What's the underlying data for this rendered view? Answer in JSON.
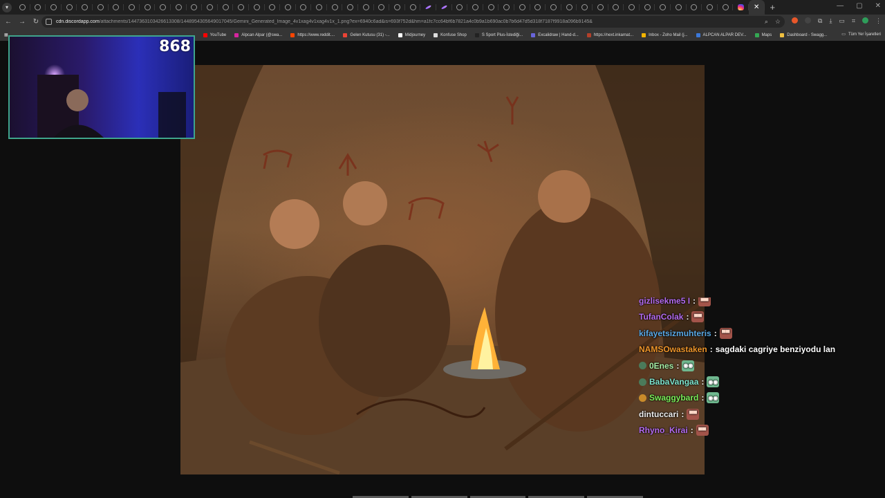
{
  "browser": {
    "tab_count": 48,
    "active_tab_close": "✕",
    "new_tab": "+",
    "url_host": "cdn.discordapp.com",
    "url_path": "/attachments/1447363103426613308/1448954305649017045/Gemini_Generated_Image_4v1xag4v1xag4v1x_1.png?ex=6940c6ad&is=693f752d&hm=a1fc7cc64bf6b7821a4c0b9a1b690ac0b7b6d47d5d318f7187f9918a096b9145&",
    "window": {
      "minimize": "—",
      "maximize": "▢",
      "close": "✕"
    }
  },
  "bookmarks": [
    {
      "label": "YouTube",
      "color": "#ff0000"
    },
    {
      "label": "Alpcan Alpar (@swa...",
      "color": "#d6249f"
    },
    {
      "label": "https://www.reddit....",
      "color": "#ff4500"
    },
    {
      "label": "Gelen Kutusu (31) -...",
      "color": "#ea4335"
    },
    {
      "label": "Midjourney",
      "color": "#ffffff"
    },
    {
      "label": "Konfuse Shop",
      "color": "#dddddd"
    },
    {
      "label": "S Sport Plus-İstediği...",
      "color": "#222222"
    },
    {
      "label": "Excalidraw | Hand-d...",
      "color": "#6965db"
    },
    {
      "label": "https://next.inkarnat...",
      "color": "#b3402a"
    },
    {
      "label": "Inbox - Zoho Mail (j...",
      "color": "#f4b400"
    },
    {
      "label": "ALPCAN ALPAR DEV...",
      "color": "#3c78d8"
    },
    {
      "label": "Maps",
      "color": "#34a853"
    },
    {
      "label": "Dashboard - Swagg...",
      "color": "#f0c040"
    }
  ],
  "bookmarks_all": "Tüm Yer İşaretleri",
  "webcam": {
    "viewer_count": "868"
  },
  "chat": [
    {
      "user": "gizlisekme5 I",
      "color": "#b46cf0",
      "badge": "",
      "emote": "rage",
      "msg": ""
    },
    {
      "user": "TufanColak",
      "color": "#b46cf0",
      "badge": "",
      "emote": "rage",
      "msg": ""
    },
    {
      "user": "kifayetsizmuhteris",
      "color": "#5aa9e6",
      "badge": "",
      "emote": "rage",
      "msg": ""
    },
    {
      "user": "NAMSOwastaken",
      "color": "#f0962a",
      "badge": "",
      "emote": "",
      "msg": "sagdaki cagriye benziyodu lan"
    },
    {
      "user": "0Enes",
      "color": "#a8f0a8",
      "badge": "pilot",
      "emote": "ogre",
      "msg": ""
    },
    {
      "user": "BabaVangaa",
      "color": "#7fe6d0",
      "badge": "pilot",
      "emote": "ogre",
      "msg": ""
    },
    {
      "user": "Swaggybard",
      "color": "#7cf05a",
      "badge": "gold",
      "emote": "ogre",
      "msg": ""
    },
    {
      "user": "dintuccari",
      "color": "#f0f0f0",
      "badge": "",
      "emote": "rage",
      "msg": ""
    },
    {
      "user": "Rhyno_Kirai",
      "color": "#b46cf0",
      "badge": "",
      "emote": "rage",
      "msg": ""
    }
  ]
}
